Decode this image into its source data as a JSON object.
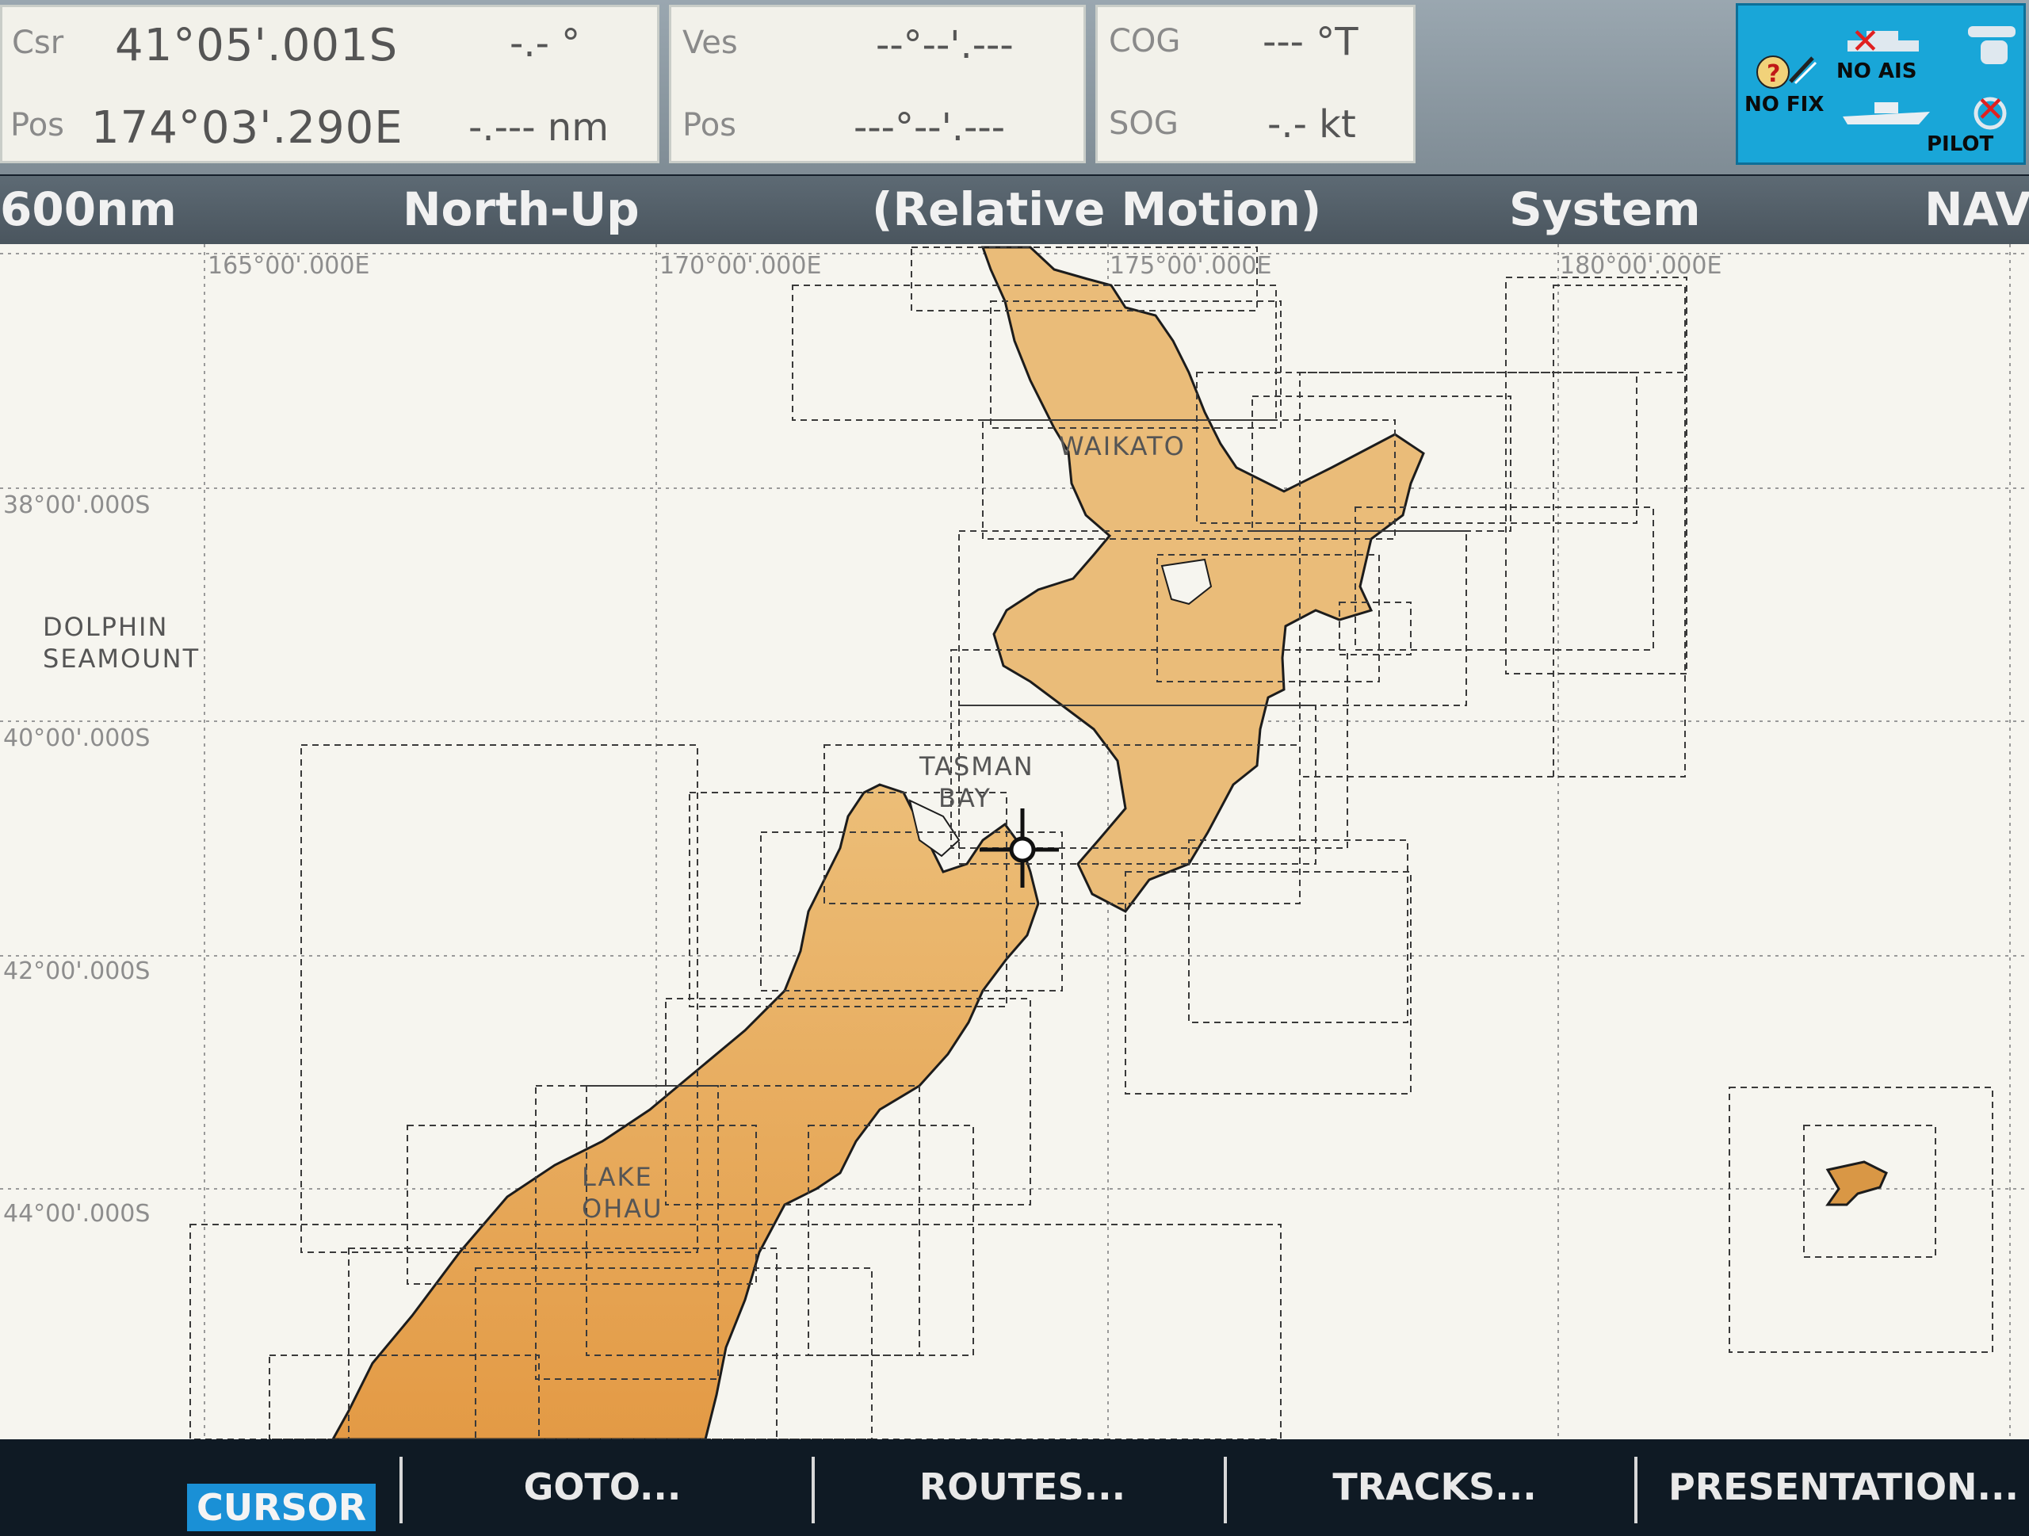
{
  "readout": {
    "csr_label": "Csr",
    "csr_lat": "41°05'.001S",
    "csr_bearing": "-.- °",
    "csr_pos_label": "Pos",
    "csr_lon": "174°03'.290E",
    "csr_range": "-.--- nm",
    "ves_label": "Ves",
    "ves_lat": "--°--'.---",
    "ves_pos_label": "Pos",
    "ves_lon": "---°--'.---",
    "cog_label": "COG",
    "cog_value": "--- °T",
    "sog_label": "SOG",
    "sog_value": "-.- kt"
  },
  "status": {
    "no_fix": "NO FIX",
    "no_ais": "NO AIS",
    "pilot": "PILOT",
    "icons": [
      "gps-no-fix-icon",
      "ais-off-icon",
      "autopilot-off-icon"
    ]
  },
  "header": {
    "range": "600nm",
    "orientation": "North-Up",
    "motion": "(Relative Motion)",
    "mode": "System",
    "nav": "NAV"
  },
  "grid": {
    "longitudes": [
      "165°00'.000E",
      "170°00'.000E",
      "175°00'.000E",
      "180°00'.000E"
    ],
    "latitudes": [
      "38°00'.000S",
      "40°00'.000S",
      "42°00'.000S",
      "44°00'.000S"
    ]
  },
  "places": {
    "dolphin_1": "DOLPHIN",
    "dolphin_2": "SEAMOUNT",
    "waikato": "WAIKATO",
    "tasman_1": "TASMAN",
    "tasman_2": "BAY",
    "lake_1": "LAKE",
    "lake_2": "OHAU"
  },
  "softkeys": {
    "cursor": "CURSOR",
    "goto": "GOTO...",
    "routes": "ROUTES...",
    "tracks": "TRACKS...",
    "presentation": "PRESENTATION..."
  },
  "colors": {
    "land": "#e9b46a",
    "land_dark": "#dc9b44",
    "sea": "#f6f5ef",
    "status_bg": "#19a6d8",
    "header_bg": "#505c66"
  }
}
